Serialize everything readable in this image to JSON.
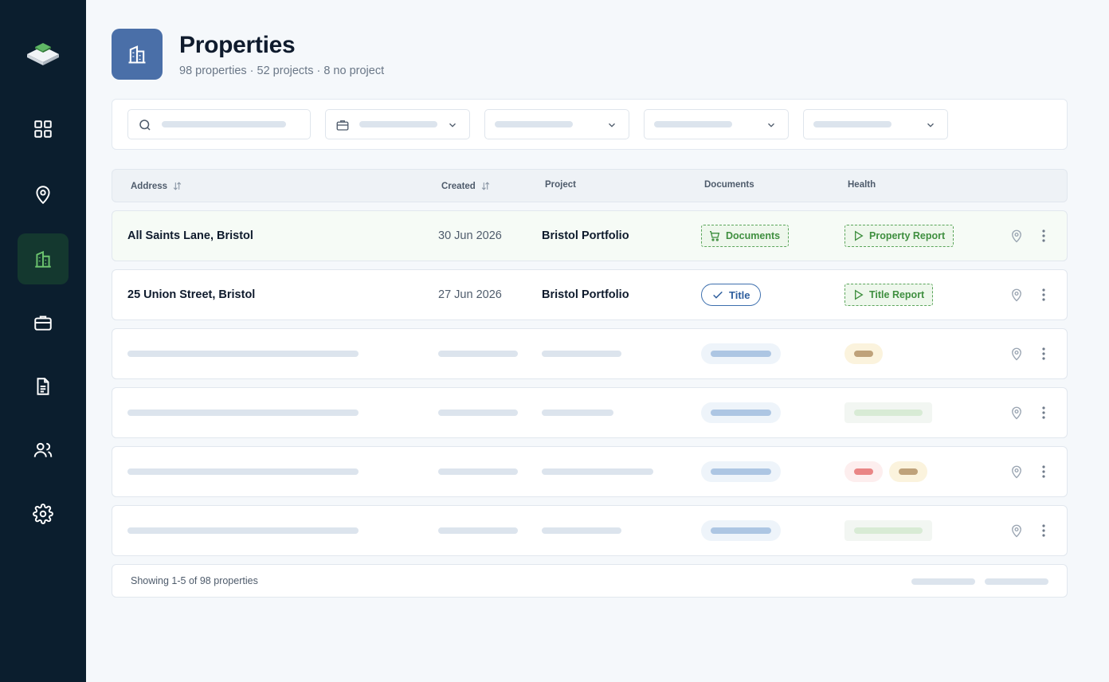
{
  "sidebar": {
    "items": [
      {
        "icon": "grid-icon"
      },
      {
        "icon": "map-pin-icon"
      },
      {
        "icon": "building-icon",
        "active": true
      },
      {
        "icon": "briefcase-icon"
      },
      {
        "icon": "document-icon"
      },
      {
        "icon": "users-icon"
      },
      {
        "icon": "gear-icon"
      }
    ]
  },
  "header": {
    "title": "Properties",
    "subtitle": "98 properties · 52 projects · 8 no project"
  },
  "table": {
    "columns": {
      "address": "Address",
      "created": "Created",
      "project": "Project",
      "documents": "Documents",
      "health": "Health"
    },
    "rows": [
      {
        "address": "All Saints Lane, Bristol",
        "created": "30 Jun 2026",
        "project": "Bristol Portfolio",
        "documents": "Documents",
        "health": "Property Report"
      },
      {
        "address": "25 Union Street, Bristol",
        "created": "27 Jun 2026",
        "project": "Bristol Portfolio",
        "documents": "Title",
        "health": "Title Report"
      }
    ],
    "footer": "Showing 1-5 of 98 properties"
  },
  "colors": {
    "sidebar_bg": "#0b1e2e",
    "accent_green": "#5aa55a",
    "accent_blue": "#4a6fa8"
  }
}
